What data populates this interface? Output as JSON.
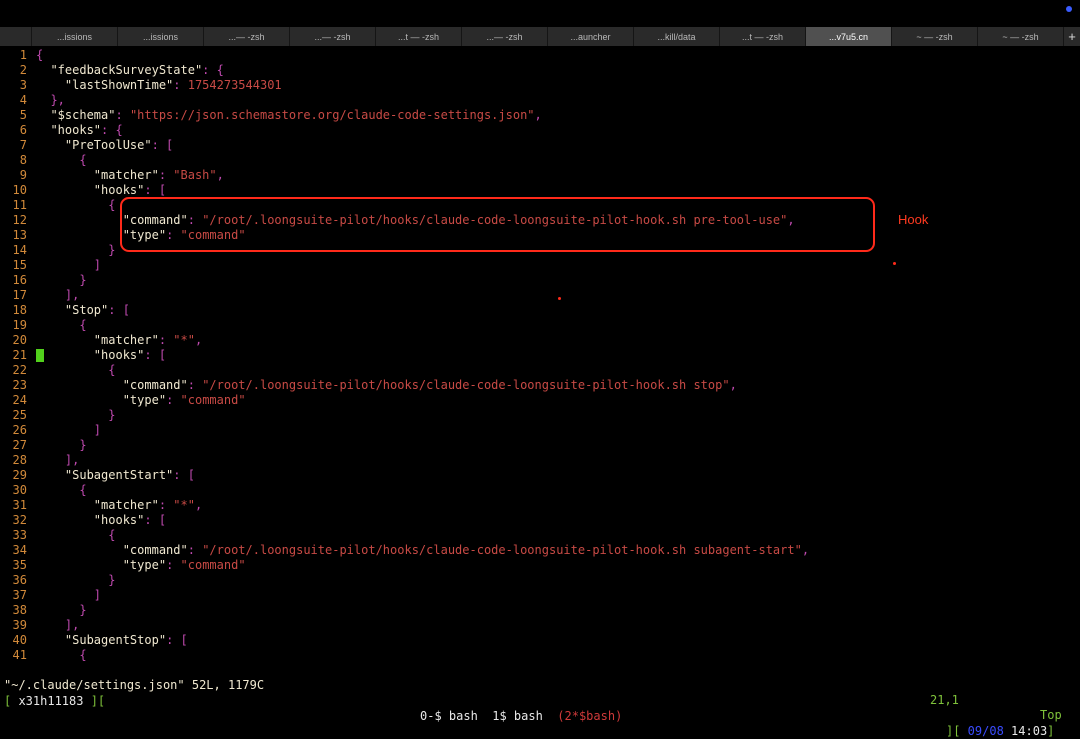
{
  "tabs": [
    {
      "label": ""
    },
    {
      "label": "...issions"
    },
    {
      "label": "...issions"
    },
    {
      "label": "...— -zsh"
    },
    {
      "label": "...— -zsh"
    },
    {
      "label": "...t — -zsh"
    },
    {
      "label": "...— -zsh"
    },
    {
      "label": "...auncher"
    },
    {
      "label": "...kill/data"
    },
    {
      "label": "...t — -zsh"
    },
    {
      "label": "...v7u5.cn"
    },
    {
      "label": "~ — -zsh"
    },
    {
      "label": "~ — -zsh"
    }
  ],
  "active_tab_index": 10,
  "new_tab_label": "+",
  "lines": [
    {
      "n": "1",
      "ind": "",
      "parts": [
        {
          "c": "p",
          "t": "{"
        }
      ]
    },
    {
      "n": "2",
      "ind": "  ",
      "parts": [
        {
          "c": "k",
          "t": "\"feedbackSurveyState\""
        },
        {
          "c": "p",
          "t": ": {"
        }
      ]
    },
    {
      "n": "3",
      "ind": "    ",
      "parts": [
        {
          "c": "k",
          "t": "\"lastShownTime\""
        },
        {
          "c": "p",
          "t": ": "
        },
        {
          "c": "n",
          "t": "1754273544301"
        }
      ]
    },
    {
      "n": "4",
      "ind": "  ",
      "parts": [
        {
          "c": "p",
          "t": "},"
        }
      ]
    },
    {
      "n": "5",
      "ind": "  ",
      "parts": [
        {
          "c": "k",
          "t": "\"$schema\""
        },
        {
          "c": "p",
          "t": ": "
        },
        {
          "c": "s",
          "t": "\"https://json.schemastore.org/claude-code-settings.json\""
        },
        {
          "c": "p",
          "t": ","
        }
      ]
    },
    {
      "n": "6",
      "ind": "  ",
      "parts": [
        {
          "c": "k",
          "t": "\"hooks\""
        },
        {
          "c": "p",
          "t": ": {"
        }
      ]
    },
    {
      "n": "7",
      "ind": "    ",
      "parts": [
        {
          "c": "k",
          "t": "\"PreToolUse\""
        },
        {
          "c": "p",
          "t": ": ["
        }
      ]
    },
    {
      "n": "8",
      "ind": "      ",
      "parts": [
        {
          "c": "p",
          "t": "{"
        }
      ]
    },
    {
      "n": "9",
      "ind": "        ",
      "parts": [
        {
          "c": "k",
          "t": "\"matcher\""
        },
        {
          "c": "p",
          "t": ": "
        },
        {
          "c": "s",
          "t": "\"Bash\""
        },
        {
          "c": "p",
          "t": ","
        }
      ]
    },
    {
      "n": "10",
      "ind": "        ",
      "parts": [
        {
          "c": "k",
          "t": "\"hooks\""
        },
        {
          "c": "p",
          "t": ": ["
        }
      ]
    },
    {
      "n": "11",
      "ind": "          ",
      "parts": [
        {
          "c": "p",
          "t": "{"
        }
      ]
    },
    {
      "n": "12",
      "ind": "            ",
      "parts": [
        {
          "c": "k",
          "t": "\"command\""
        },
        {
          "c": "p",
          "t": ": "
        },
        {
          "c": "s",
          "t": "\"/root/.loongsuite-pilot/hooks/claude-code-loongsuite-pilot-hook.sh pre-tool-use\""
        },
        {
          "c": "p",
          "t": ","
        }
      ]
    },
    {
      "n": "13",
      "ind": "            ",
      "parts": [
        {
          "c": "k",
          "t": "\"type\""
        },
        {
          "c": "p",
          "t": ": "
        },
        {
          "c": "s",
          "t": "\"command\""
        }
      ]
    },
    {
      "n": "14",
      "ind": "          ",
      "parts": [
        {
          "c": "p",
          "t": "}"
        }
      ]
    },
    {
      "n": "15",
      "ind": "        ",
      "parts": [
        {
          "c": "p",
          "t": "]"
        }
      ]
    },
    {
      "n": "16",
      "ind": "      ",
      "parts": [
        {
          "c": "p",
          "t": "}"
        }
      ]
    },
    {
      "n": "17",
      "ind": "    ",
      "parts": [
        {
          "c": "p",
          "t": "],"
        }
      ]
    },
    {
      "n": "18",
      "ind": "    ",
      "parts": [
        {
          "c": "k",
          "t": "\"Stop\""
        },
        {
          "c": "p",
          "t": ": ["
        }
      ]
    },
    {
      "n": "19",
      "ind": "      ",
      "parts": [
        {
          "c": "p",
          "t": "{"
        }
      ]
    },
    {
      "n": "20",
      "ind": "        ",
      "parts": [
        {
          "c": "k",
          "t": "\"matcher\""
        },
        {
          "c": "p",
          "t": ": "
        },
        {
          "c": "s",
          "t": "\"*\""
        },
        {
          "c": "p",
          "t": ","
        }
      ]
    },
    {
      "n": "21",
      "ind": "        ",
      "parts": [
        {
          "c": "k",
          "t": "\"hooks\""
        },
        {
          "c": "p",
          "t": ": ["
        }
      ]
    },
    {
      "n": "22",
      "ind": "          ",
      "parts": [
        {
          "c": "p",
          "t": "{"
        }
      ]
    },
    {
      "n": "23",
      "ind": "            ",
      "parts": [
        {
          "c": "k",
          "t": "\"command\""
        },
        {
          "c": "p",
          "t": ": "
        },
        {
          "c": "s",
          "t": "\"/root/.loongsuite-pilot/hooks/claude-code-loongsuite-pilot-hook.sh stop\""
        },
        {
          "c": "p",
          "t": ","
        }
      ]
    },
    {
      "n": "24",
      "ind": "            ",
      "parts": [
        {
          "c": "k",
          "t": "\"type\""
        },
        {
          "c": "p",
          "t": ": "
        },
        {
          "c": "s",
          "t": "\"command\""
        }
      ]
    },
    {
      "n": "25",
      "ind": "          ",
      "parts": [
        {
          "c": "p",
          "t": "}"
        }
      ]
    },
    {
      "n": "26",
      "ind": "        ",
      "parts": [
        {
          "c": "p",
          "t": "]"
        }
      ]
    },
    {
      "n": "27",
      "ind": "      ",
      "parts": [
        {
          "c": "p",
          "t": "}"
        }
      ]
    },
    {
      "n": "28",
      "ind": "    ",
      "parts": [
        {
          "c": "p",
          "t": "],"
        }
      ]
    },
    {
      "n": "29",
      "ind": "    ",
      "parts": [
        {
          "c": "k",
          "t": "\"SubagentStart\""
        },
        {
          "c": "p",
          "t": ": ["
        }
      ]
    },
    {
      "n": "30",
      "ind": "      ",
      "parts": [
        {
          "c": "p",
          "t": "{"
        }
      ]
    },
    {
      "n": "31",
      "ind": "        ",
      "parts": [
        {
          "c": "k",
          "t": "\"matcher\""
        },
        {
          "c": "p",
          "t": ": "
        },
        {
          "c": "s",
          "t": "\"*\""
        },
        {
          "c": "p",
          "t": ","
        }
      ]
    },
    {
      "n": "32",
      "ind": "        ",
      "parts": [
        {
          "c": "k",
          "t": "\"hooks\""
        },
        {
          "c": "p",
          "t": ": ["
        }
      ]
    },
    {
      "n": "33",
      "ind": "          ",
      "parts": [
        {
          "c": "p",
          "t": "{"
        }
      ]
    },
    {
      "n": "34",
      "ind": "            ",
      "parts": [
        {
          "c": "k",
          "t": "\"command\""
        },
        {
          "c": "p",
          "t": ": "
        },
        {
          "c": "s",
          "t": "\"/root/.loongsuite-pilot/hooks/claude-code-loongsuite-pilot-hook.sh subagent-start\""
        },
        {
          "c": "p",
          "t": ","
        }
      ]
    },
    {
      "n": "35",
      "ind": "            ",
      "parts": [
        {
          "c": "k",
          "t": "\"type\""
        },
        {
          "c": "p",
          "t": ": "
        },
        {
          "c": "s",
          "t": "\"command\""
        }
      ]
    },
    {
      "n": "36",
      "ind": "          ",
      "parts": [
        {
          "c": "p",
          "t": "}"
        }
      ]
    },
    {
      "n": "37",
      "ind": "        ",
      "parts": [
        {
          "c": "p",
          "t": "]"
        }
      ]
    },
    {
      "n": "38",
      "ind": "      ",
      "parts": [
        {
          "c": "p",
          "t": "}"
        }
      ]
    },
    {
      "n": "39",
      "ind": "    ",
      "parts": [
        {
          "c": "p",
          "t": "],"
        }
      ]
    },
    {
      "n": "40",
      "ind": "    ",
      "parts": [
        {
          "c": "k",
          "t": "\"SubagentStop\""
        },
        {
          "c": "p",
          "t": ": ["
        }
      ]
    },
    {
      "n": "41",
      "ind": "      ",
      "parts": [
        {
          "c": "p",
          "t": "{"
        }
      ]
    }
  ],
  "cursor_line": "21",
  "annotation": {
    "label": "Hook"
  },
  "vim_status": {
    "file_info": "\"~/.claude/settings.json\" 52L, 1179C",
    "position": "21,1",
    "scroll": "Top"
  },
  "tmux": {
    "session_open": "[ ",
    "session": "x31h11183",
    "session_close": " ][",
    "windows": [
      {
        "label": "0-$ bash",
        "active": false
      },
      {
        "label": "1$ bash",
        "active": false
      },
      {
        "label": "(2*$bash)",
        "active": true
      }
    ],
    "right_open": "][",
    "date": " 09/08",
    "time": "14:03",
    "right_close": "]"
  },
  "colors": {
    "line_number": "#d28a3a",
    "key": "#f0e8d0",
    "string": "#c84a45",
    "punctuation": "#c04ab0",
    "cursor": "#52d11c",
    "annotation": "#ff2a1a",
    "tmux_green": "#7ec13a",
    "tmux_blue": "#3a4cff"
  }
}
